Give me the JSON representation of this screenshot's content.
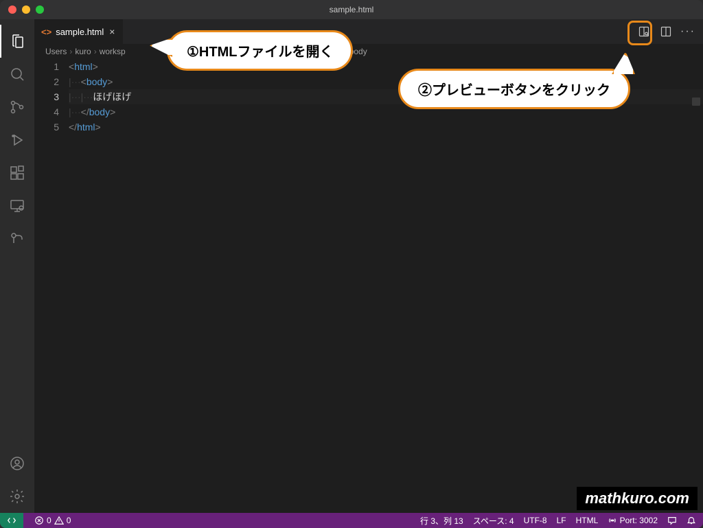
{
  "window": {
    "title": "sample.html"
  },
  "tab": {
    "label": "sample.html"
  },
  "breadcrumbs": {
    "parts": [
      "Users",
      "kuro",
      "worksp"
    ],
    "tail": "body"
  },
  "editor": {
    "lines": {
      "l1": {
        "num": "1",
        "open": "<",
        "tag": "html",
        "close": ">"
      },
      "l2": {
        "num": "2",
        "open": "<",
        "tag": "body",
        "close": ">"
      },
      "l3": {
        "num": "3",
        "text": "ほげほげ"
      },
      "l4": {
        "num": "4",
        "open": "</",
        "tag": "body",
        "close": ">"
      },
      "l5": {
        "num": "5",
        "open": "</",
        "tag": "html",
        "close": ">"
      }
    }
  },
  "statusbar": {
    "errors": "0",
    "warnings": "0",
    "pos": "行 3、列 13",
    "spaces": "スペース: 4",
    "encoding": "UTF-8",
    "eol": "LF",
    "lang": "HTML",
    "port": "Port: 3002"
  },
  "annotations": {
    "step1": "①HTMLファイルを開く",
    "step2": "②プレビューボタンをクリック"
  },
  "watermark": "mathkuro.com"
}
